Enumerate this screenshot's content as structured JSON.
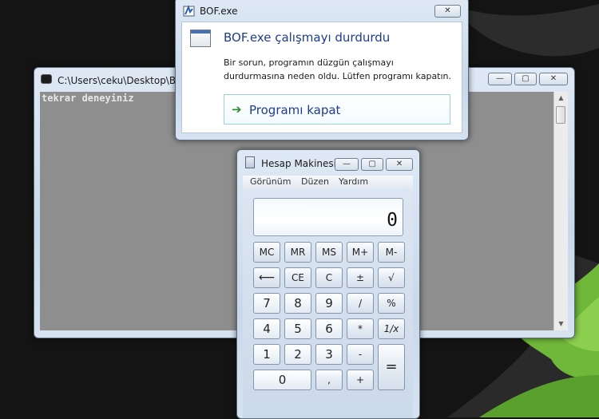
{
  "console": {
    "title": "C:\\Users\\ceku\\Desktop\\BOF.exe",
    "output": "tekrar deneyiniz",
    "scroll_up": "▲",
    "scroll_down": "▼"
  },
  "error_dialog": {
    "title": "BOF.exe",
    "heading": "BOF.exe çalışmayı durdurdu",
    "description": "Bir sorun, programın düzgün çalışmayı durdurmasına neden oldu. Lütfen programı kapatın.",
    "close_program_label": "Programı kapat",
    "close_program_arrow": "➔"
  },
  "calculator": {
    "title": "Hesap Makinesi",
    "menu": [
      "Görünüm",
      "Düzen",
      "Yardım"
    ],
    "display_value": "0",
    "memory_keys": [
      "MC",
      "MR",
      "MS",
      "M+",
      "M-"
    ],
    "row2_keys": [
      "⟵",
      "CE",
      "C",
      "±",
      "√"
    ],
    "row3_keys": [
      "7",
      "8",
      "9",
      "/",
      "%"
    ],
    "row4_keys": [
      "4",
      "5",
      "6",
      "*",
      "1/x"
    ],
    "row5_keys": [
      "1",
      "2",
      "3",
      "-"
    ],
    "equals_key": "=",
    "zero_key": "0",
    "decimal_key": ",",
    "plus_key": "+"
  },
  "window_controls": {
    "minimize": "—",
    "maximize": "▢",
    "close": "✕"
  },
  "colors": {
    "desktop": "#141414",
    "accent_green": "#6fb83a",
    "console_bg": "#8e8e8e",
    "dialog_heading": "#1e3d8f"
  }
}
